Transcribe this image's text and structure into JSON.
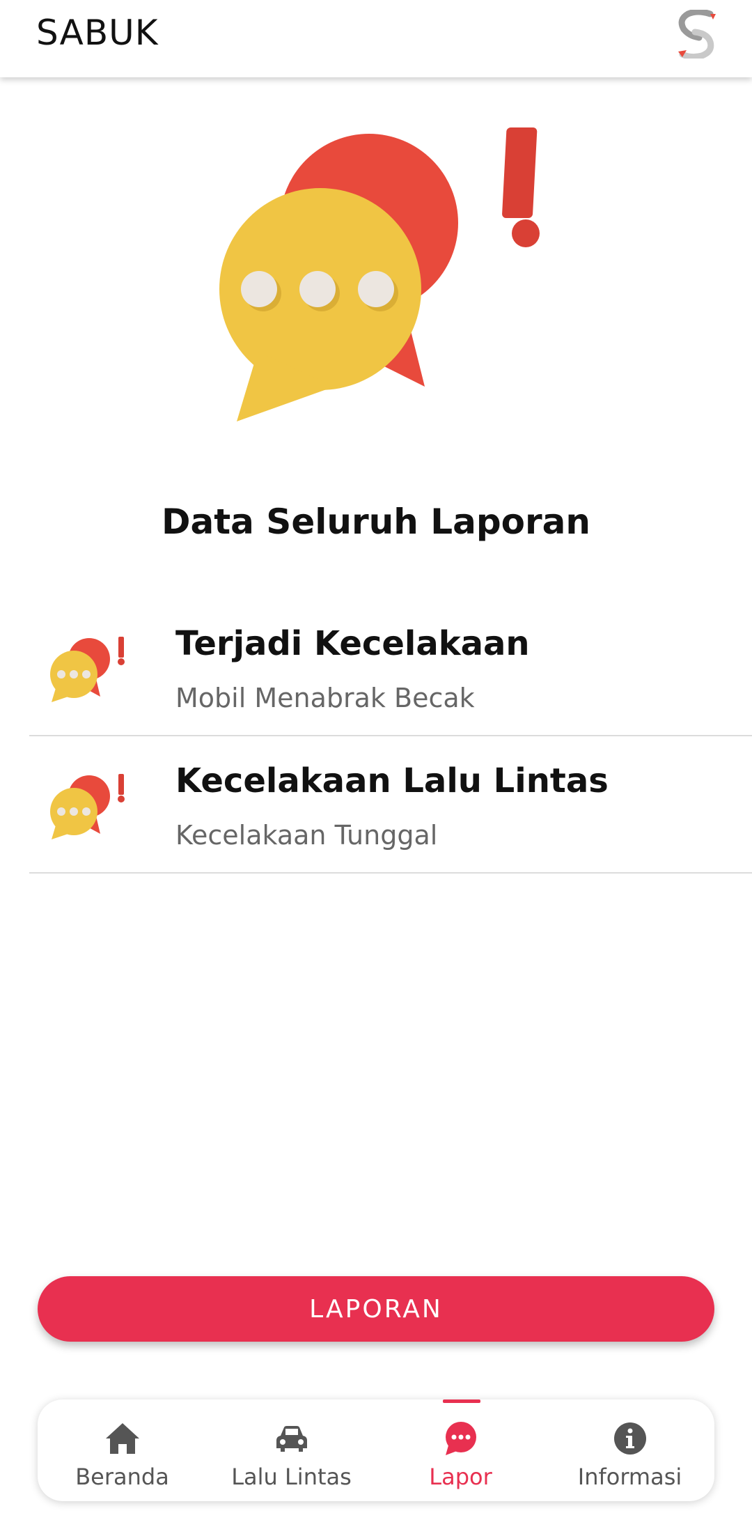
{
  "app": {
    "title": "SABUK"
  },
  "section": {
    "title": "Data Seluruh Laporan"
  },
  "reports": [
    {
      "title": "Terjadi Kecelakaan",
      "subtitle": "Mobil Menabrak Becak"
    },
    {
      "title": "Kecelakaan Lalu Lintas",
      "subtitle": "Kecelakaan Tunggal"
    }
  ],
  "action": {
    "label": "LAPORAN"
  },
  "nav": {
    "items": [
      {
        "label": "Beranda",
        "icon": "home-icon"
      },
      {
        "label": "Lalu Lintas",
        "icon": "car-icon"
      },
      {
        "label": "Lapor",
        "icon": "chat-icon"
      },
      {
        "label": "Informasi",
        "icon": "info-icon"
      }
    ],
    "active": "Lapor"
  },
  "colors": {
    "accent": "#e83050",
    "bubble_red": "#e84a3c",
    "bubble_yellow": "#f0c544",
    "icon_gray": "#555555"
  }
}
